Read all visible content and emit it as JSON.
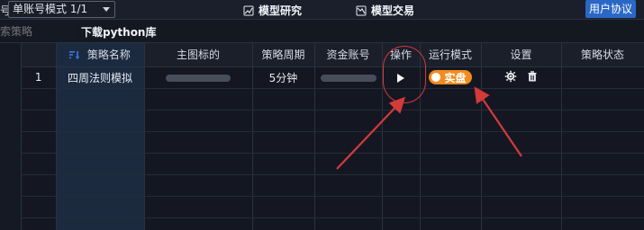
{
  "top": {
    "prefix": "号",
    "mode_value": "单账号模式 1/1",
    "tabs": [
      {
        "label": "模型研究"
      },
      {
        "label": "模型交易"
      }
    ],
    "agreement_label": "用户协议"
  },
  "subbar": {
    "search_placeholder": "索策略",
    "download_label": "下载python库"
  },
  "table": {
    "columns": [
      "",
      "策略名称",
      "主图标的",
      "策略周期",
      "资金账号",
      "操作",
      "运行模式",
      "设置",
      "策略状态"
    ],
    "rows": [
      {
        "index": "1",
        "name": "四周法则模拟",
        "symbol_masked": "",
        "period": "5分钟",
        "account_masked": "",
        "run_mode": "实盘",
        "status": ""
      }
    ]
  },
  "icons": {
    "sort": "sort-icon",
    "play": "play-icon",
    "gear": "gear-icon",
    "trash": "trash-icon"
  },
  "colors": {
    "accent_blue": "#2b68c6",
    "run_orange": "#f28b1e",
    "annotation_red": "#d33a3a"
  }
}
